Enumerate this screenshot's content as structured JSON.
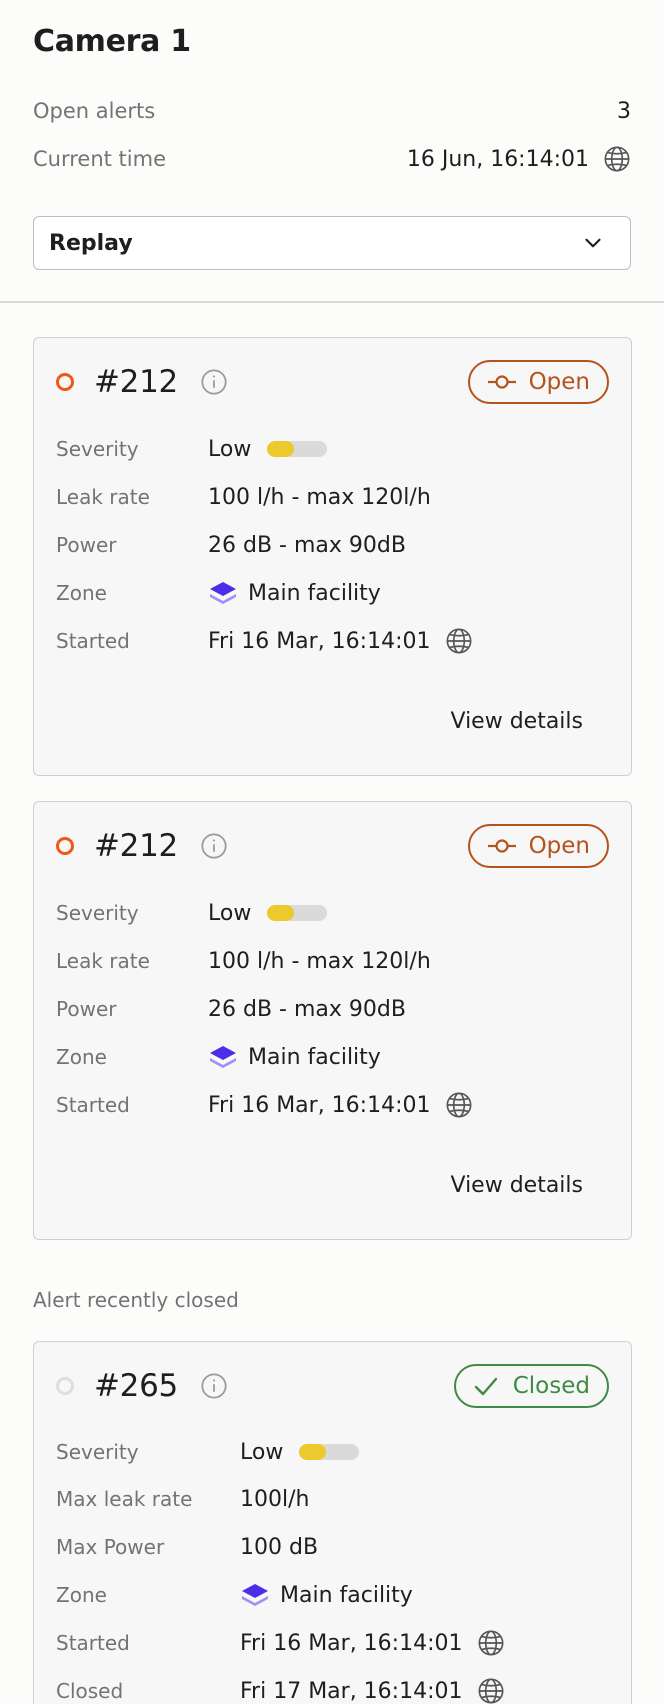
{
  "header": {
    "title": "Camera 1",
    "open_alerts_label": "Open alerts",
    "open_alerts_value": "3",
    "current_time_label": "Current time",
    "current_time_value": "16 Jun, 16:14:01",
    "mode_select": {
      "selected": "Replay",
      "icon": "chevron-down-icon"
    }
  },
  "labels": {
    "severity": "Severity",
    "leak_rate": "Leak rate",
    "power": "Power",
    "zone": "Zone",
    "started": "Started",
    "max_leak_rate": "Max leak rate",
    "max_power": "Max Power",
    "closed": "Closed",
    "view_details": "View details",
    "recently_closed": "Alert recently closed"
  },
  "alerts": [
    {
      "id": "#212",
      "status": "Open",
      "severity": "Low",
      "severity_level": 0.45,
      "leak_rate": "100 l/h - max 120l/h",
      "power": "26 dB - max 90dB",
      "zone": "Main facility",
      "started": "Fri 16 Mar, 16:14:01"
    },
    {
      "id": "#212",
      "status": "Open",
      "severity": "Low",
      "severity_level": 0.45,
      "leak_rate": "100 l/h - max 120l/h",
      "power": "26 dB - max 90dB",
      "zone": "Main facility",
      "started": "Fri 16 Mar, 16:14:01"
    }
  ],
  "closed_alert": {
    "id": "#265",
    "status": "Closed",
    "severity": "Low",
    "severity_level": 0.45,
    "max_leak_rate": "100l/h",
    "max_power": "100 dB",
    "zone": "Main facility",
    "started": "Fri 16 Mar, 16:14:01",
    "closed": "Fri 17 Mar, 16:14:01"
  },
  "colors": {
    "open_dot": "#f2571a",
    "open_badge": "#b4541c",
    "closed_badge": "#3f8a46",
    "severity_low": "#ecc92c",
    "zone_icon": "#4b2ee8"
  }
}
